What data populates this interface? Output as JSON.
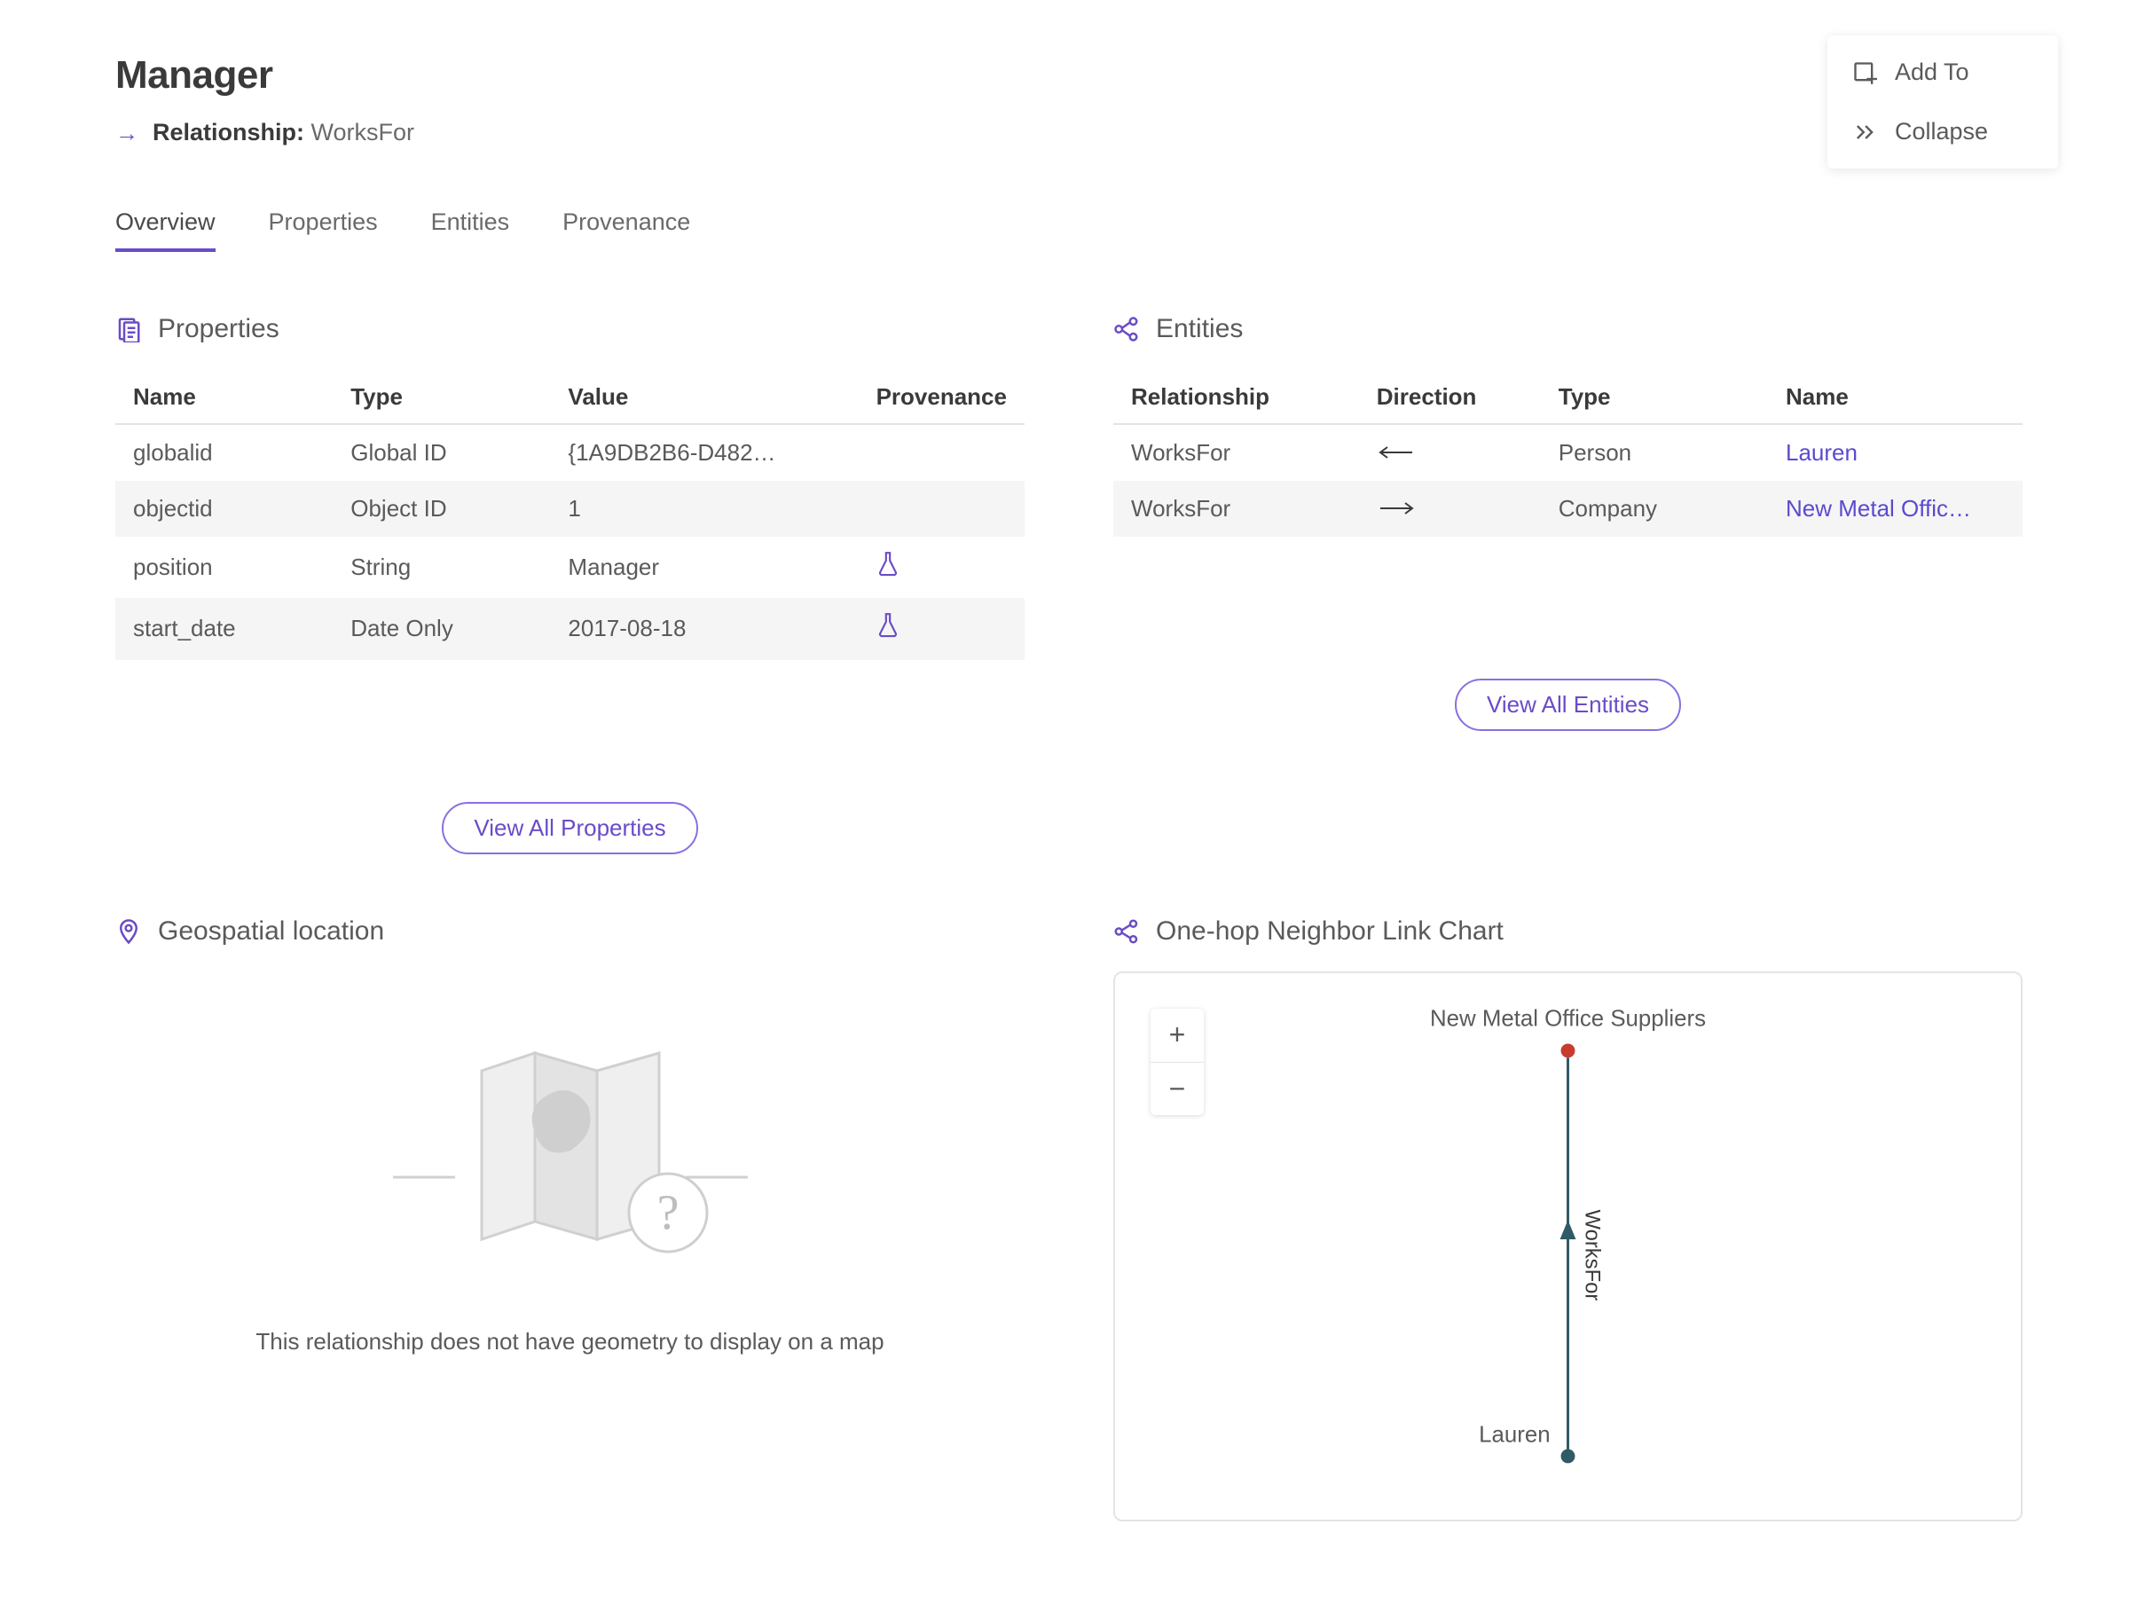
{
  "header": {
    "title": "Manager",
    "subtitle_label": "Relationship:",
    "subtitle_value": "WorksFor"
  },
  "actions": {
    "add_to": "Add To",
    "collapse": "Collapse"
  },
  "tabs": {
    "overview": "Overview",
    "properties": "Properties",
    "entities": "Entities",
    "provenance": "Provenance"
  },
  "properties_section": {
    "title": "Properties",
    "columns": {
      "name": "Name",
      "type": "Type",
      "value": "Value",
      "provenance": "Provenance"
    },
    "rows": [
      {
        "name": "globalid",
        "type": "Global ID",
        "value": "{1A9DB2B6-D482…",
        "has_prov": false
      },
      {
        "name": "objectid",
        "type": "Object ID",
        "value": "1",
        "has_prov": false
      },
      {
        "name": "position",
        "type": "String",
        "value": "Manager",
        "has_prov": true
      },
      {
        "name": "start_date",
        "type": "Date Only",
        "value": "2017-08-18",
        "has_prov": true
      }
    ],
    "view_all": "View All Properties"
  },
  "entities_section": {
    "title": "Entities",
    "columns": {
      "relationship": "Relationship",
      "direction": "Direction",
      "type": "Type",
      "name": "Name"
    },
    "rows": [
      {
        "relationship": "WorksFor",
        "direction": "left",
        "type": "Person",
        "name": "Lauren"
      },
      {
        "relationship": "WorksFor",
        "direction": "right",
        "type": "Company",
        "name": "New Metal Offic…"
      }
    ],
    "view_all": "View All Entities"
  },
  "geospatial": {
    "title": "Geospatial location",
    "note": "This relationship does not have geometry to display on a map"
  },
  "link_chart": {
    "title": "One-hop Neighbor Link Chart",
    "top_node": "New Metal Office Suppliers",
    "bottom_node": "Lauren",
    "edge_label": "WorksFor"
  },
  "colors": {
    "accent": "#6a4cc7"
  }
}
